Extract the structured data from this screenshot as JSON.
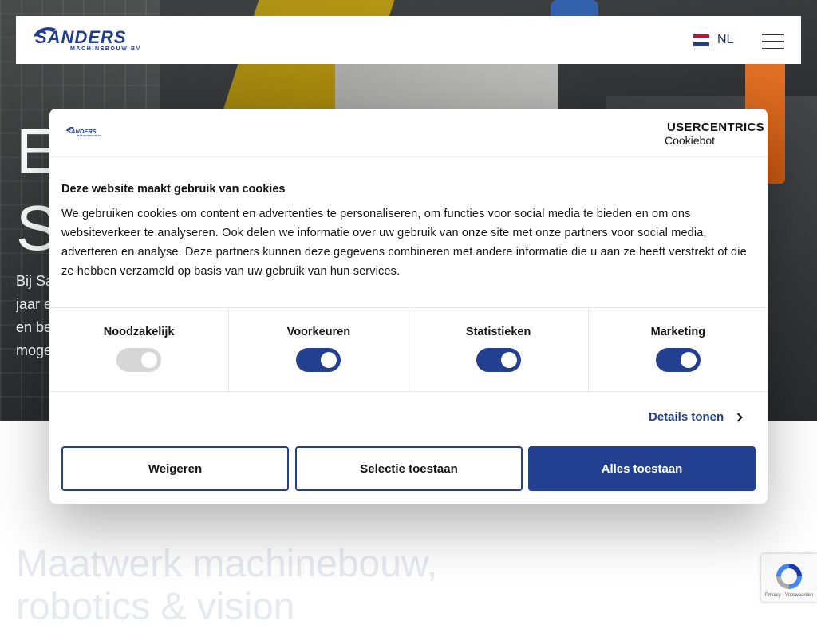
{
  "header": {
    "logo_text": "SANDERS",
    "logo_subtext": "MACHINEBOUW BV",
    "language": "NL"
  },
  "hero": {
    "title_line1": "E",
    "title_line2": "S",
    "text_lines": [
      "Bij Sa",
      "jaar e",
      "en be",
      "moge"
    ]
  },
  "page": {
    "subtitle_line1": "Maatwerk machinebouw,",
    "subtitle_line2": "robotics & vision"
  },
  "recaptcha": {
    "footer_text": "Privacy - Voorwaarden"
  },
  "cookie_dialog": {
    "brand_name": "USERCENTRICS",
    "brand_product": "Cookiebot",
    "title": "Deze website maakt gebruik van cookies",
    "body": "We gebruiken cookies om content en advertenties te personaliseren, om functies voor social media te bieden en om ons websiteverkeer te analyseren. Ook delen we informatie over uw gebruik van onze site met onze partners voor social media, adverteren en analyse. Deze partners kunnen deze gegevens combineren met andere informatie die u aan ze heeft verstrekt of die ze hebben verzameld op basis van uw gebruik van hun services.",
    "categories": [
      {
        "label": "Noodzakelijk",
        "checked": true,
        "disabled": true
      },
      {
        "label": "Voorkeuren",
        "checked": true,
        "disabled": false
      },
      {
        "label": "Statistieken",
        "checked": true,
        "disabled": false
      },
      {
        "label": "Marketing",
        "checked": true,
        "disabled": false
      }
    ],
    "details_link": "Details tonen",
    "buttons": {
      "deny": "Weigeren",
      "allow_selection": "Selectie toestaan",
      "allow_all": "Alles toestaan"
    }
  },
  "colors": {
    "brand_blue": "#233f8f",
    "toggle_disabled": "#d6d6d6"
  },
  "icons": {
    "flag": "netherlands-flag-icon",
    "menu": "hamburger-menu-icon",
    "chevron": "chevron-right-icon",
    "shield": "usercentrics-shield-icon",
    "recaptcha": "recaptcha-icon"
  }
}
